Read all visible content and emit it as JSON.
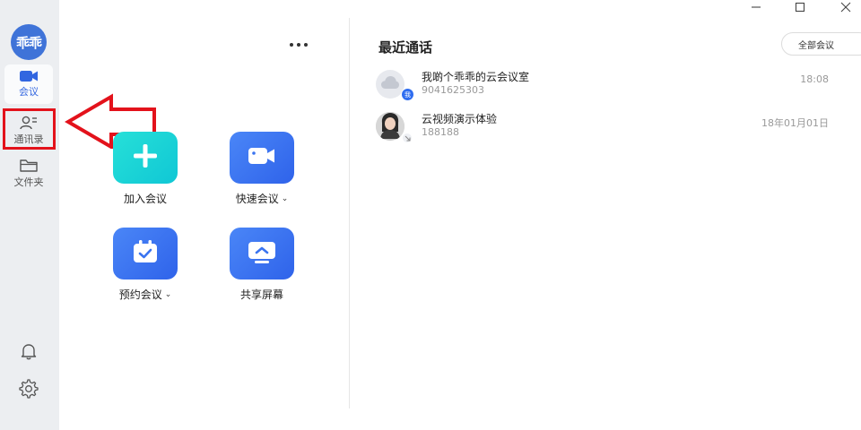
{
  "logo": {
    "text": "乖乖"
  },
  "sidebar": {
    "items": [
      {
        "label": "会议",
        "icon": "video-camera-icon"
      },
      {
        "label": "通讯录",
        "icon": "contacts-icon"
      },
      {
        "label": "文件夹",
        "icon": "folder-icon"
      }
    ],
    "active_index": 0
  },
  "actions": [
    {
      "label": "加入会议",
      "icon": "plus-icon",
      "has_dropdown": false,
      "color": "#1bd4d6"
    },
    {
      "label": "快速会议",
      "icon": "video-camera-icon",
      "has_dropdown": true,
      "color": "#3a74f0"
    },
    {
      "label": "预约会议",
      "icon": "calendar-check-icon",
      "has_dropdown": true,
      "color": "#3a74f0"
    },
    {
      "label": "共享屏幕",
      "icon": "share-screen-icon",
      "has_dropdown": false,
      "color": "#3a74f0"
    }
  ],
  "dropdown_glyph": "⌄",
  "recent": {
    "title": "最近通话",
    "all_meetings_label": "全部会议",
    "calls": [
      {
        "name": "我啲个乖乖的云会议室",
        "number": "9041625303",
        "time": "18:08",
        "badge": "我"
      },
      {
        "name": "云视频演示体验",
        "number": "188188",
        "time": "18年01月01日"
      }
    ]
  },
  "colors": {
    "accent": "#3266e0",
    "annotation": "#e3121b",
    "sidebar_bg": "#eceef1"
  }
}
